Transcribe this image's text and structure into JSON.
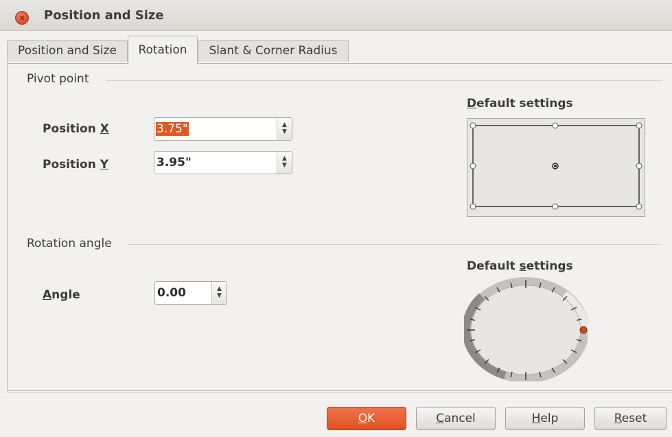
{
  "window": {
    "title": "Position and Size"
  },
  "tabs": [
    {
      "label": "Position and Size",
      "active": false
    },
    {
      "label": "Rotation",
      "active": true
    },
    {
      "label": "Slant & Corner Radius",
      "active": false
    }
  ],
  "pivot": {
    "section_label": "Pivot point",
    "position_x": {
      "label_prefix": "Position ",
      "mnemonic": "X",
      "value": "3.75\"",
      "selected": true
    },
    "position_y": {
      "label_prefix": "Position ",
      "mnemonic": "Y",
      "value": "3.95\""
    },
    "default_settings": {
      "mnemonic": "D",
      "label_rest": "efault settings",
      "selected_point": "center"
    }
  },
  "rotation": {
    "section_label": "Rotation angle",
    "angle": {
      "mnemonic": "A",
      "label_rest": "ngle",
      "value": "0.00"
    },
    "default_settings": {
      "label_prefix": "Default ",
      "mnemonic": "s",
      "label_rest": "ettings",
      "angle_degrees": 0
    }
  },
  "buttons": {
    "ok": {
      "mnemonic": "O",
      "rest": "K"
    },
    "cancel": {
      "mnemonic": "C",
      "rest": "ancel"
    },
    "help": {
      "mnemonic": "H",
      "rest": "elp"
    },
    "reset": {
      "mnemonic": "R",
      "rest": "eset"
    }
  },
  "colors": {
    "accent": "#e05821",
    "window_bg": "#f2f1f0"
  }
}
